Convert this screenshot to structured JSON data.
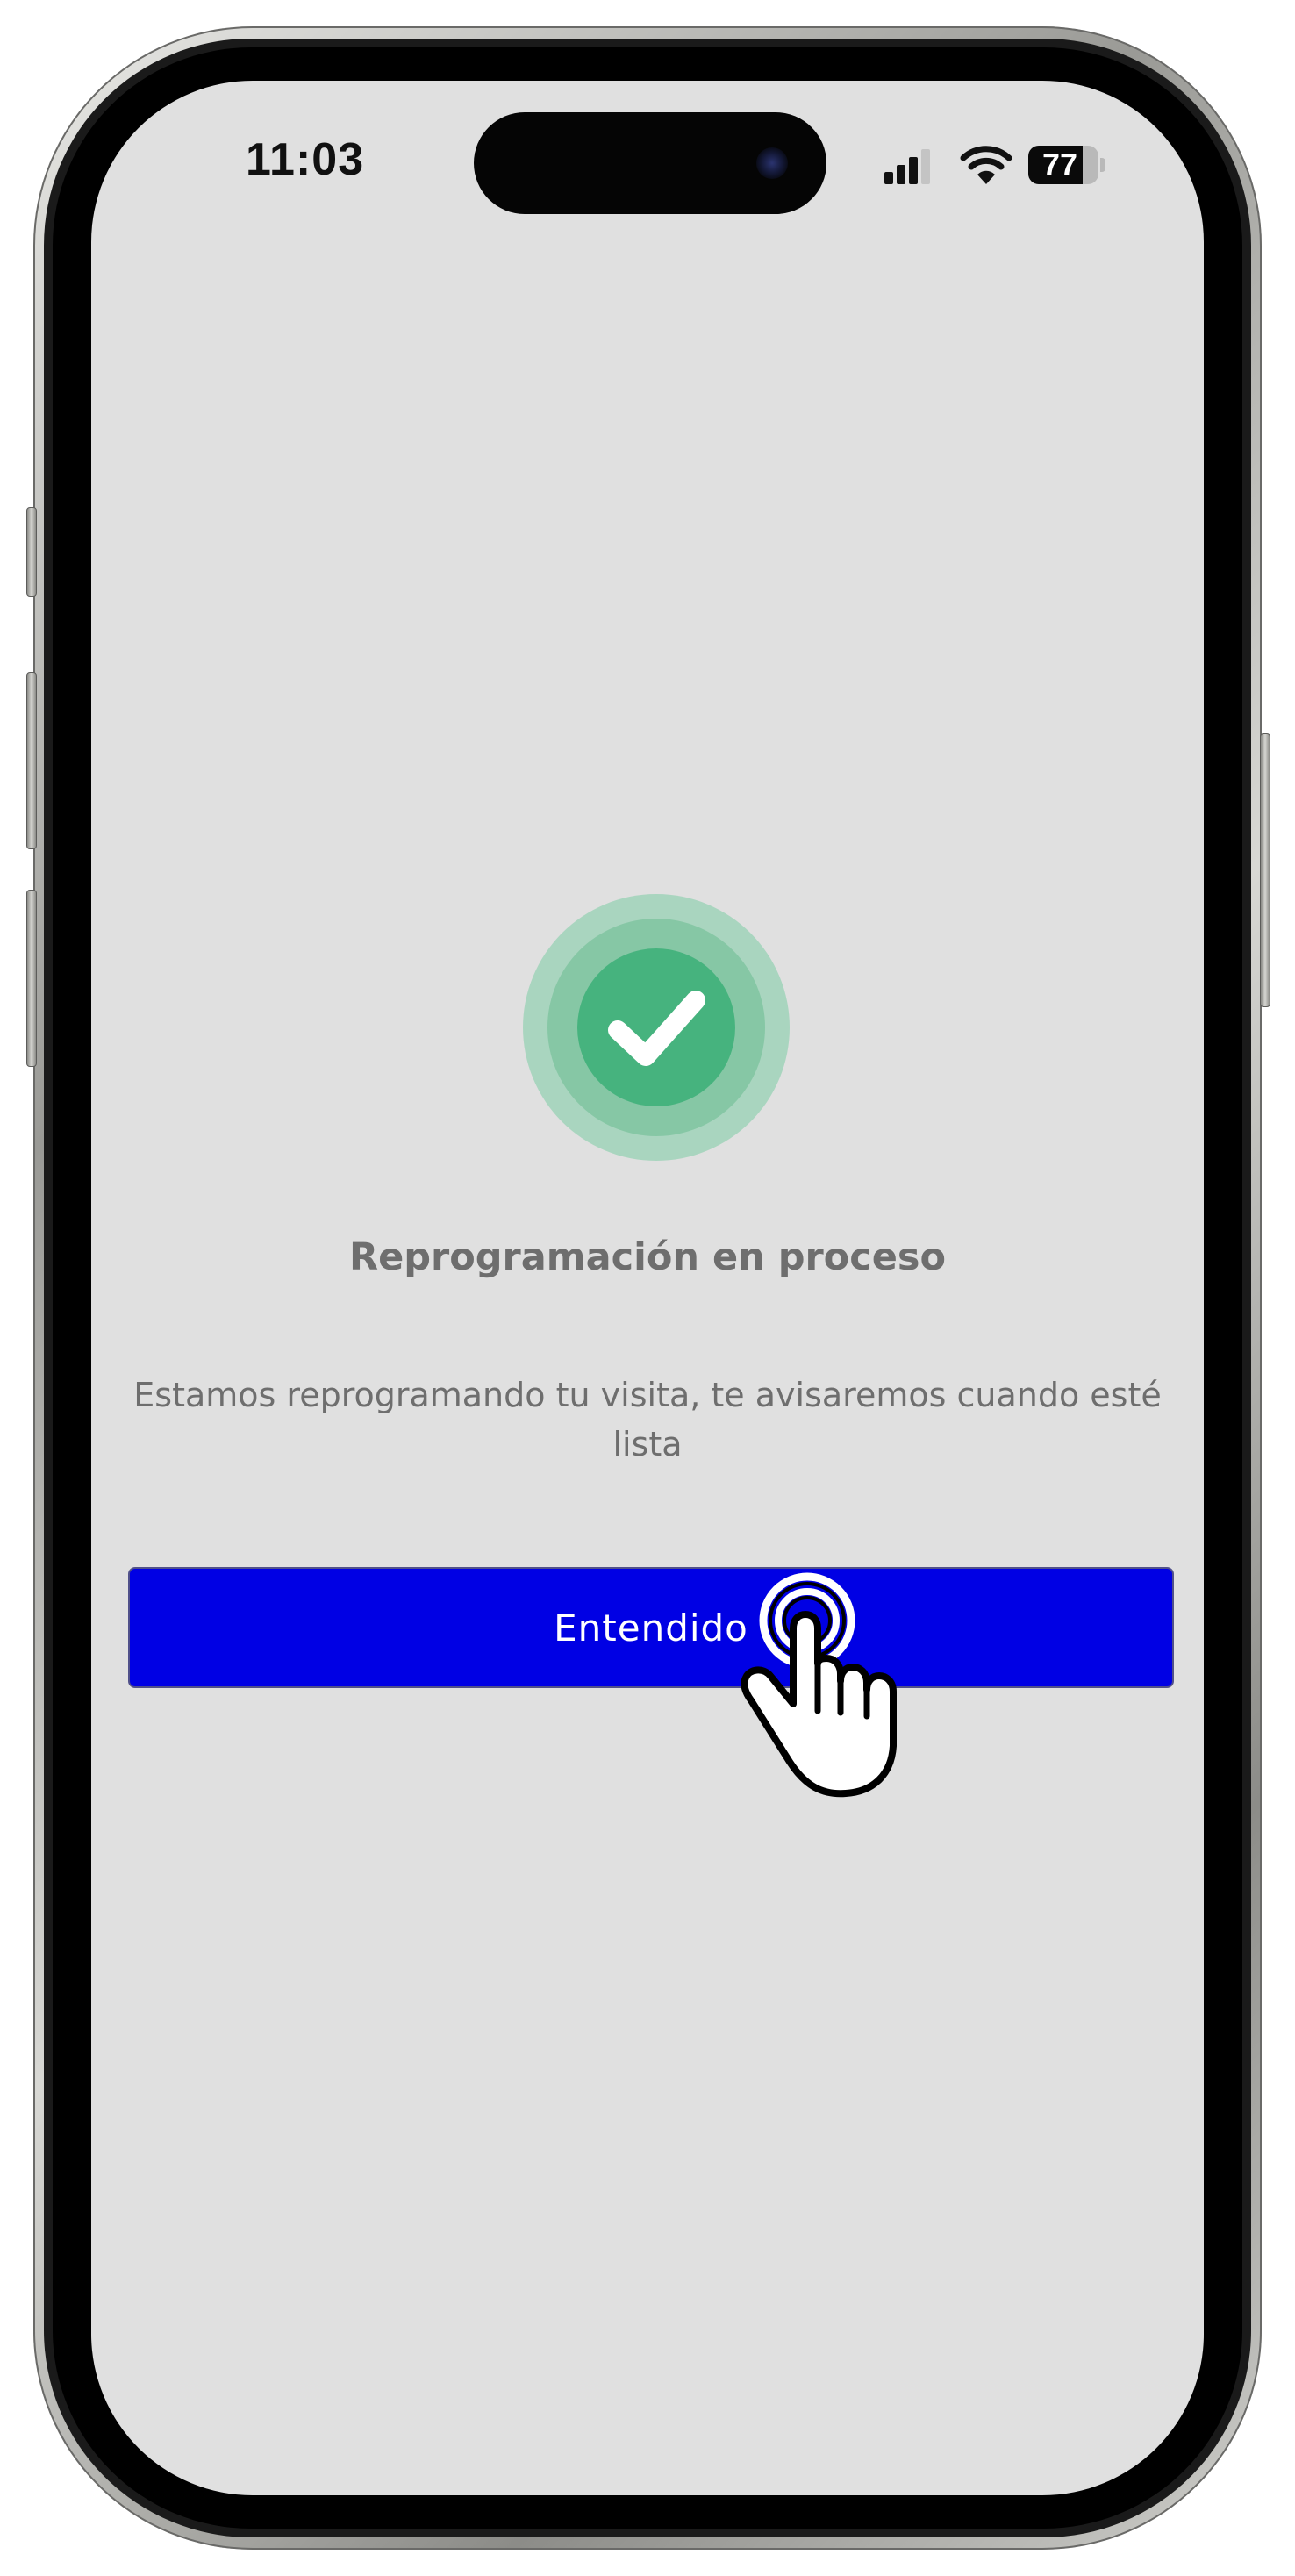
{
  "status_bar": {
    "time": "11:03",
    "battery_level": "77",
    "battery_fraction": 0.77
  },
  "success": {
    "icon": "check-circle-icon",
    "title": "Reprogramación en proceso",
    "message": "Estamos reprogramando tu visita, te avisaremos cuando esté lista"
  },
  "actions": {
    "confirm_label": "Entendido"
  },
  "colors": {
    "screen_background": "#e0e0e0",
    "button_background": "#0000e4",
    "success_green": "#46b37e",
    "text_gray": "#6e6e6e"
  },
  "overlay": {
    "cursor_icon": "hand-pointer-tap-icon"
  }
}
